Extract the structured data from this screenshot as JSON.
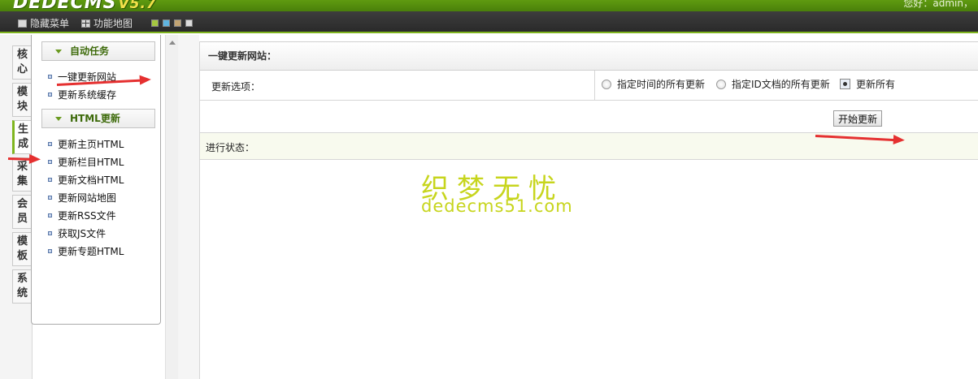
{
  "app": {
    "logo_text": "DEDECMS",
    "logo_version": "V5.7",
    "welcome_text": "您好：admin，"
  },
  "menubar": {
    "hide_menu_label": "隐藏菜单",
    "function_map_label": "功能地图",
    "theme_colors": [
      "#a5c840",
      "#5fb4e0",
      "#c2a472",
      "#dcdcdc"
    ]
  },
  "vtabs": [
    {
      "label": "核心"
    },
    {
      "label": "模块"
    },
    {
      "label": "生成",
      "active": true
    },
    {
      "label": "采集"
    },
    {
      "label": "会员"
    },
    {
      "label": "模板"
    },
    {
      "label": "系统"
    }
  ],
  "sidemenu": {
    "groups": [
      {
        "title": "自动任务",
        "items": [
          "一键更新网站",
          "更新系统缓存"
        ]
      },
      {
        "title": "HTML更新",
        "items": [
          "更新主页HTML",
          "更新栏目HTML",
          "更新文档HTML",
          "更新网站地图",
          "更新RSS文件",
          "获取JS文件",
          "更新专题HTML"
        ]
      }
    ]
  },
  "main": {
    "panel_title": "一键更新网站：",
    "options_label": "更新选项：",
    "options": [
      {
        "label": "指定时间的所有更新",
        "checked": false
      },
      {
        "label": "指定ID文档的所有更新",
        "checked": false
      },
      {
        "label": "更新所有",
        "checked": true
      }
    ],
    "start_button": "开始更新",
    "status_label": "进行状态："
  },
  "watermark": {
    "line1": "织梦无忧",
    "line2": "dedecms51.com"
  },
  "colors": {
    "accent": "#7fb51f",
    "arrow": "#e53030",
    "watermark": "#c7d51d"
  }
}
